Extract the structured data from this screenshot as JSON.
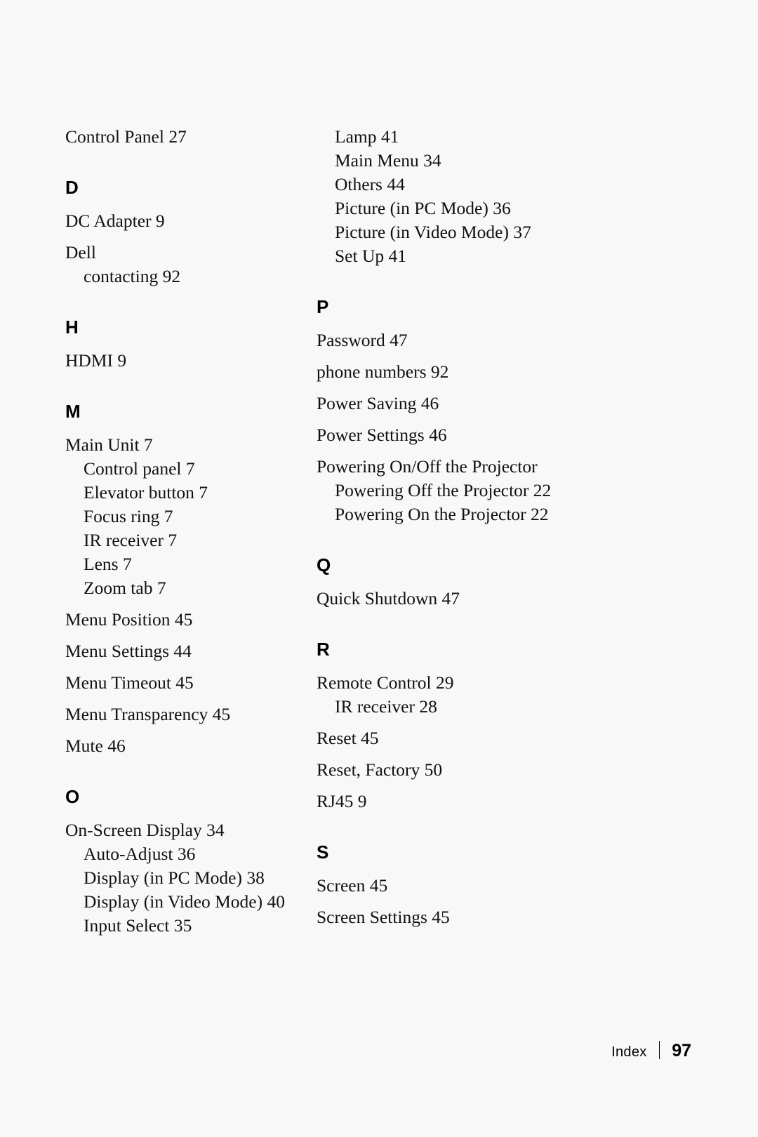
{
  "document": {
    "type": "book-index",
    "page_number": "97",
    "footer_label": "Index",
    "footer_separator": "|",
    "background_color": "#f7f8f7",
    "text_color": "#111111"
  },
  "columns": [
    {
      "name": "left-column",
      "blocks": [
        {
          "kind": "entries",
          "items": [
            {
              "text": "Control Panel 27",
              "level": 1
            }
          ]
        },
        {
          "kind": "section",
          "letter": "D",
          "items": [
            {
              "text": "DC Adapter 9",
              "level": 1
            },
            {
              "text": "Dell",
              "level": 1
            },
            {
              "text": "contacting 92",
              "level": 2
            }
          ]
        },
        {
          "kind": "section",
          "letter": "H",
          "items": [
            {
              "text": "HDMI 9",
              "level": 1
            }
          ]
        },
        {
          "kind": "section",
          "letter": "M",
          "items": [
            {
              "text": "Main Unit 7",
              "level": 1
            },
            {
              "text": "Control panel 7",
              "level": 2
            },
            {
              "text": "Elevator button 7",
              "level": 2
            },
            {
              "text": "Focus ring 7",
              "level": 2
            },
            {
              "text": "IR receiver 7",
              "level": 2
            },
            {
              "text": "Lens 7",
              "level": 2
            },
            {
              "text": "Zoom tab 7",
              "level": 2
            },
            {
              "text": "Menu Position 45",
              "level": 1
            },
            {
              "text": "Menu Settings 44",
              "level": 1
            },
            {
              "text": "Menu Timeout 45",
              "level": 1
            },
            {
              "text": "Menu Transparency 45",
              "level": 1
            },
            {
              "text": "Mute 46",
              "level": 1
            }
          ]
        },
        {
          "kind": "section",
          "letter": "O",
          "items": [
            {
              "text": "On-Screen Display 34",
              "level": 1
            },
            {
              "text": "Auto-Adjust 36",
              "level": 2
            },
            {
              "text": "Display (in PC Mode) 38",
              "level": 2
            },
            {
              "text": "Display (in Video Mode) 40",
              "level": 2
            },
            {
              "text": "Input Select 35",
              "level": 2
            }
          ]
        }
      ]
    },
    {
      "name": "right-column",
      "blocks": [
        {
          "kind": "entries",
          "items": [
            {
              "text": "Lamp 41",
              "level": 2
            },
            {
              "text": "Main Menu 34",
              "level": 2
            },
            {
              "text": "Others 44",
              "level": 2
            },
            {
              "text": "Picture (in PC Mode) 36",
              "level": 2
            },
            {
              "text": "Picture (in Video Mode) 37",
              "level": 2
            },
            {
              "text": "Set Up 41",
              "level": 2
            }
          ]
        },
        {
          "kind": "section",
          "letter": "P",
          "items": [
            {
              "text": "Password 47",
              "level": 1
            },
            {
              "text": "phone numbers 92",
              "level": 1
            },
            {
              "text": "Power Saving 46",
              "level": 1
            },
            {
              "text": "Power Settings 46",
              "level": 1
            },
            {
              "text": "Powering On/Off the Projector",
              "level": 1
            },
            {
              "text": "Powering Off the Projector 22",
              "level": 2
            },
            {
              "text": "Powering On the Projector 22",
              "level": 2
            }
          ]
        },
        {
          "kind": "section",
          "letter": "Q",
          "items": [
            {
              "text": "Quick Shutdown 47",
              "level": 1
            }
          ]
        },
        {
          "kind": "section",
          "letter": "R",
          "items": [
            {
              "text": "Remote Control 29",
              "level": 1
            },
            {
              "text": "IR receiver 28",
              "level": 2
            },
            {
              "text": "Reset 45",
              "level": 1
            },
            {
              "text": "Reset, Factory 50",
              "level": 1
            },
            {
              "text": "RJ45 9",
              "level": 1
            }
          ]
        },
        {
          "kind": "section",
          "letter": "S",
          "items": [
            {
              "text": "Screen 45",
              "level": 1
            },
            {
              "text": "Screen Settings 45",
              "level": 1
            }
          ]
        }
      ]
    }
  ]
}
